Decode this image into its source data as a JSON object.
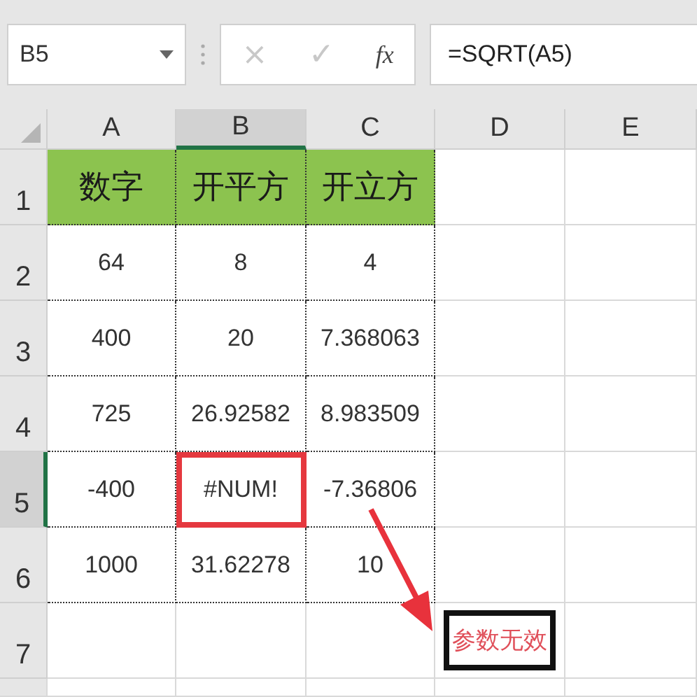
{
  "formula_bar": {
    "name_box": "B5",
    "cancel": "×",
    "enter": "✓",
    "function": "fx",
    "formula": "=SQRT(A5)"
  },
  "columns": [
    {
      "label": "A",
      "selected": false
    },
    {
      "label": "B",
      "selected": true
    },
    {
      "label": "C",
      "selected": false
    },
    {
      "label": "D",
      "selected": false
    },
    {
      "label": "E",
      "selected": false
    }
  ],
  "rows": [
    {
      "label": "1",
      "selected": false,
      "cells": [
        {
          "text": "数字",
          "kind": "header"
        },
        {
          "text": "开平方",
          "kind": "header"
        },
        {
          "text": "开立方",
          "kind": "header"
        },
        null,
        null
      ]
    },
    {
      "label": "2",
      "selected": false,
      "cells": [
        {
          "text": "64",
          "kind": "value"
        },
        {
          "text": "8",
          "kind": "value"
        },
        {
          "text": "4",
          "kind": "value"
        },
        null,
        null
      ]
    },
    {
      "label": "3",
      "selected": false,
      "cells": [
        {
          "text": "400",
          "kind": "value"
        },
        {
          "text": "20",
          "kind": "value"
        },
        {
          "text": "7.368063",
          "kind": "value"
        },
        null,
        null
      ]
    },
    {
      "label": "4",
      "selected": false,
      "cells": [
        {
          "text": "725",
          "kind": "value"
        },
        {
          "text": "26.92582",
          "kind": "value"
        },
        {
          "text": "8.983509",
          "kind": "value"
        },
        null,
        null
      ]
    },
    {
      "label": "5",
      "selected": true,
      "cells": [
        {
          "text": "-400",
          "kind": "value"
        },
        {
          "text": "#NUM!",
          "kind": "value",
          "highlighted": true
        },
        {
          "text": "-7.36806",
          "kind": "value"
        },
        null,
        null
      ]
    },
    {
      "label": "6",
      "selected": false,
      "cells": [
        {
          "text": "1000",
          "kind": "value"
        },
        {
          "text": "31.62278",
          "kind": "value"
        },
        {
          "text": "10",
          "kind": "value"
        },
        null,
        null
      ]
    },
    {
      "label": "7",
      "selected": false,
      "cells": [
        null,
        null,
        null,
        {
          "text": "参数无效",
          "kind": "callout"
        },
        null
      ]
    }
  ]
}
